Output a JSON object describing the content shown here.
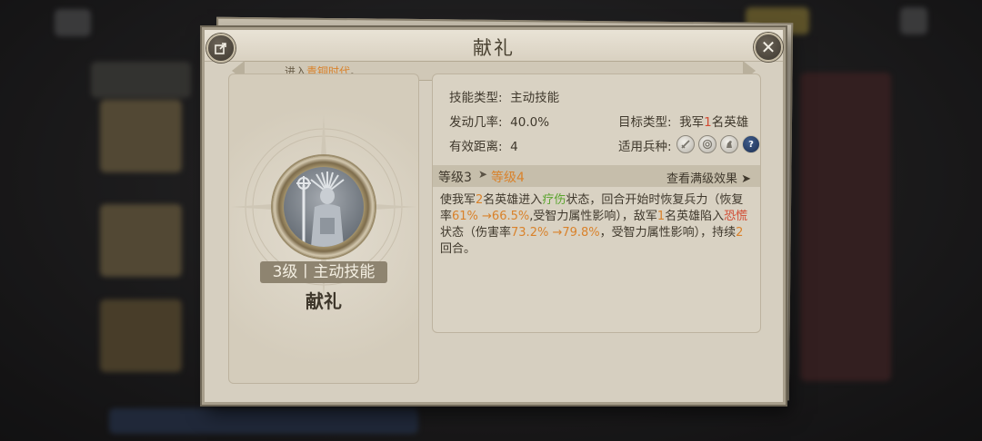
{
  "modal": {
    "title": "献礼",
    "ribbon_prefix": "进入",
    "ribbon_era": "青铜时代",
    "ribbon_suffix": "。"
  },
  "left": {
    "level_badge": "3级丨主动技能",
    "skill_name": "献礼"
  },
  "info": {
    "skill_type_label": "技能类型:",
    "skill_type_value": "主动技能",
    "trigger_label": "发动几率:",
    "trigger_value": "40.0%",
    "range_label": "有效距离:",
    "range_value": "4",
    "target_label": "目标类型:",
    "target_prefix": "我军",
    "target_count": "1",
    "target_suffix": "名英雄",
    "troop_label": "适用兵种:",
    "troops": [
      "sword-icon",
      "target-icon",
      "horse-icon",
      "question-icon"
    ]
  },
  "level": {
    "current": "等级3",
    "arrow": "➤",
    "next": "等级4",
    "view_max": "查看满级效果 ➤"
  },
  "description": {
    "p1": "使我军",
    "n1": "2",
    "p2": "名英雄进入",
    "s1": "疗伤",
    "p3": "状态，回合开始时恢复兵力（恢复率",
    "r1": "61% →66.5%",
    "p4": ",受智力属性影响），敌军",
    "n2": "1",
    "p5": "名英雄陷入",
    "s2": "恐慌",
    "p6": "状态（伤害率",
    "r2": "73.2% →79.8%",
    "p7": "，受智力属性影响），持续",
    "n3": "2",
    "p8": "回合。"
  },
  "colors": {
    "orange": "#d9822b",
    "red": "#d24a32",
    "green": "#5aa42d"
  }
}
